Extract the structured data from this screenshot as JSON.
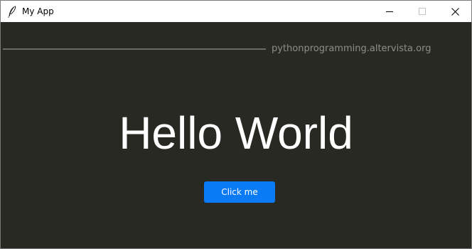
{
  "window": {
    "title": "My App",
    "icon": "feather-icon",
    "controls": [
      "minimize-icon",
      "maximize-icon",
      "close-icon"
    ]
  },
  "content": {
    "site_label": "pythonprogramming.altervista.org",
    "heading": "Hello World",
    "button_label": "Click me"
  },
  "colors": {
    "background": "#282923",
    "rule": "#6b6b66",
    "site_label": "#8e8e8a",
    "heading": "#ffffff",
    "button": "#0a7bf5",
    "button_text": "#ffffff"
  }
}
